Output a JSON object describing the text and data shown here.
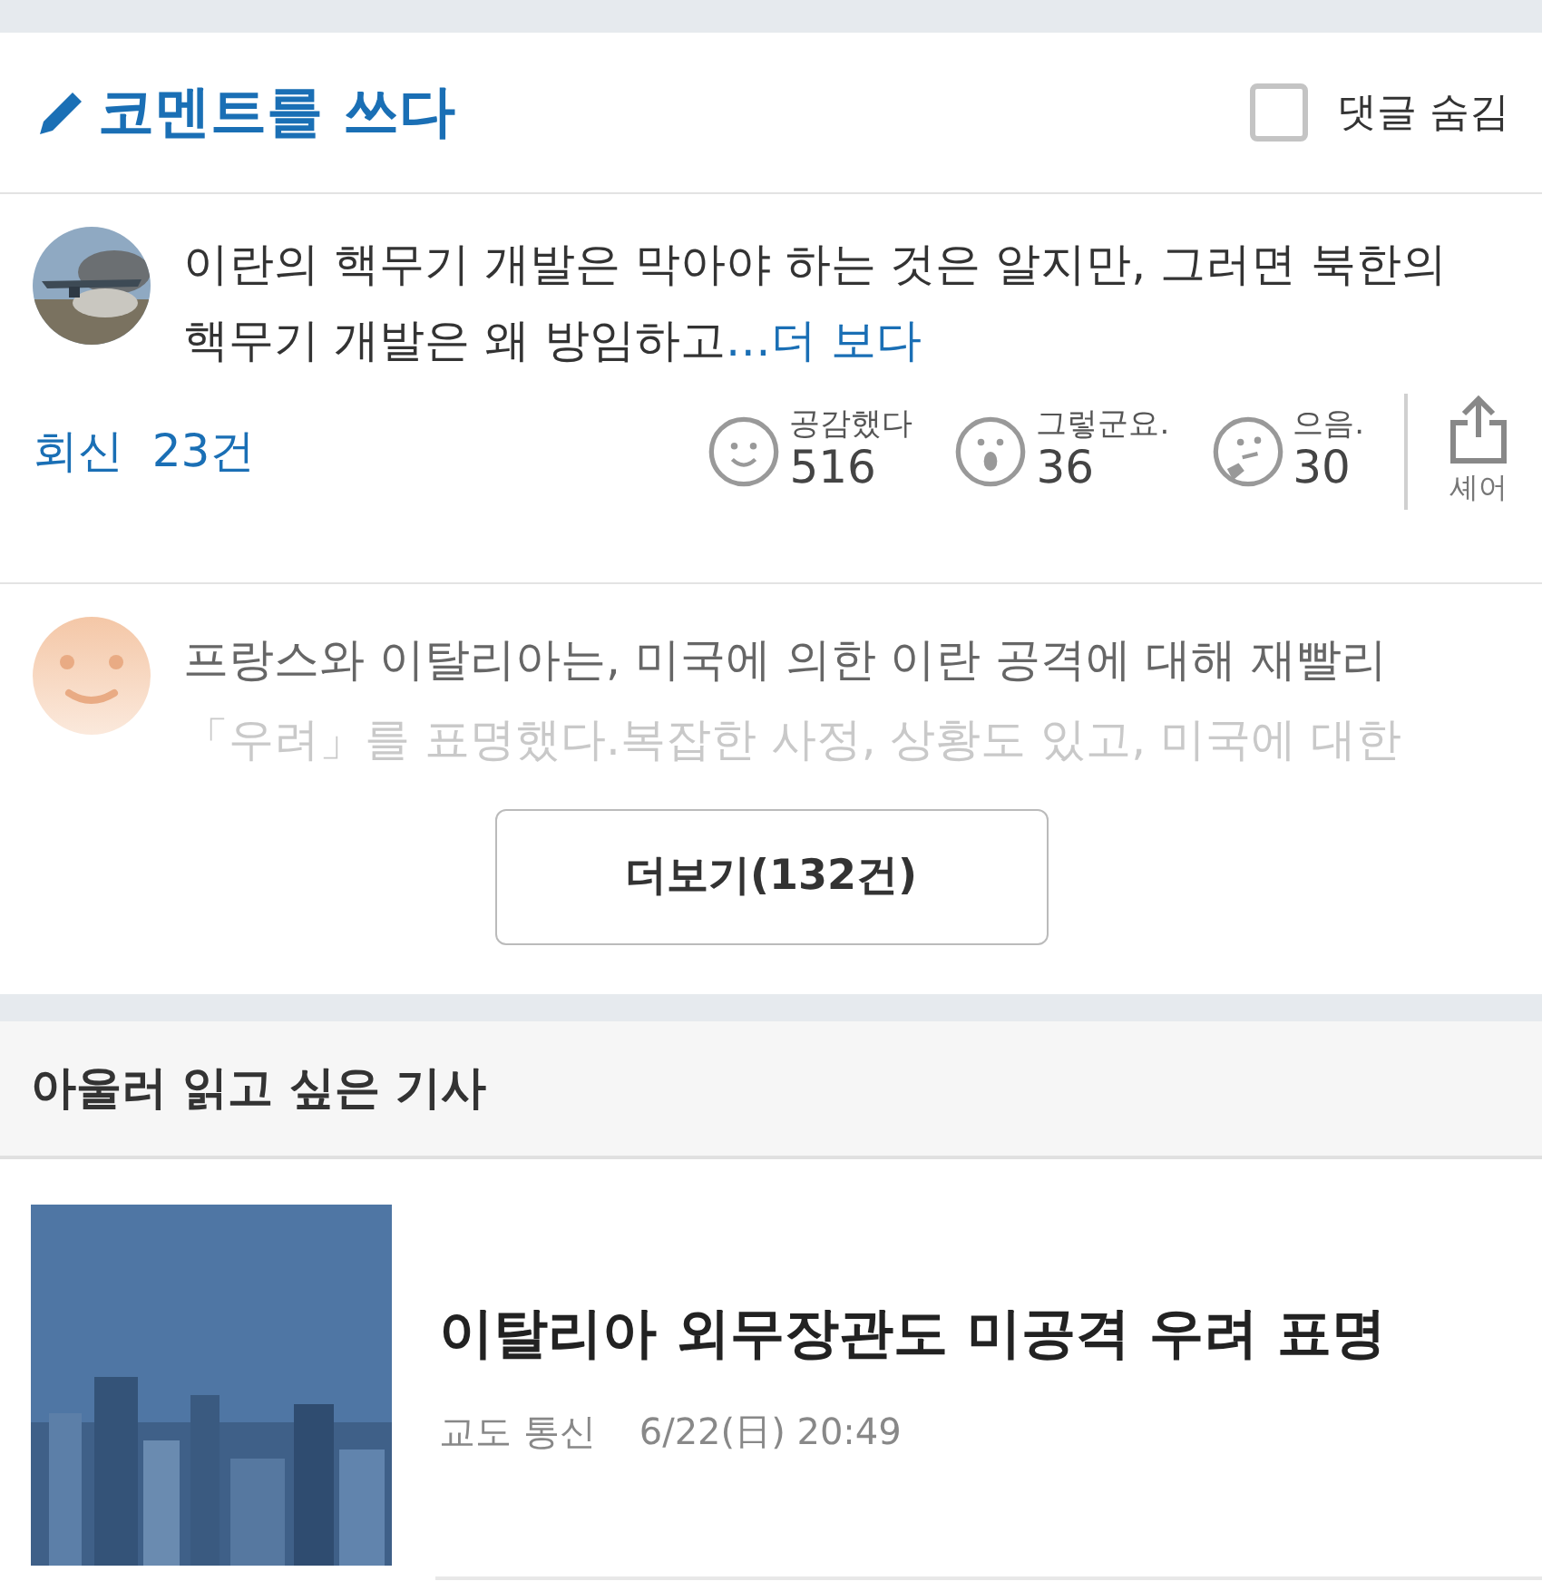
{
  "comment_header": {
    "title": "코멘트를 쓰다",
    "hide_replies": {
      "label": "댓글 숨김",
      "checked": false
    }
  },
  "comments": [
    {
      "text": "이란의 핵무기 개발은 막아야 하는 것은 알지만, 그러면 북한의 핵무기 개발은 왜 방임하고",
      "more": "…더 보다",
      "replies": "회신  23건",
      "reactions": [
        {
          "kind": "smile",
          "label": "공감했다",
          "count": "516"
        },
        {
          "kind": "surprised",
          "label": "그렇군요.",
          "count": "36"
        },
        {
          "kind": "thinking",
          "label": "으음.",
          "count": "30"
        }
      ],
      "share": "셰어"
    },
    {
      "kind": "default",
      "lines": [
        "프랑스와 이탈리아는, 미국에 의한 이란 공격에 대해 재빨리",
        "「우려」를 표명했다.복잡한 사정, 상황도 있고, 미국에 대한"
      ]
    }
  ],
  "more_button": "더보기(132건)",
  "related": {
    "title": "아울러 읽고 싶은 기사",
    "articles": [
      {
        "kind": "picture",
        "headline": "이탈리아 외무장관도 미공격 우려 표명",
        "source": "교도 통신",
        "date": "6/22(日) 20:49"
      }
    ]
  }
}
